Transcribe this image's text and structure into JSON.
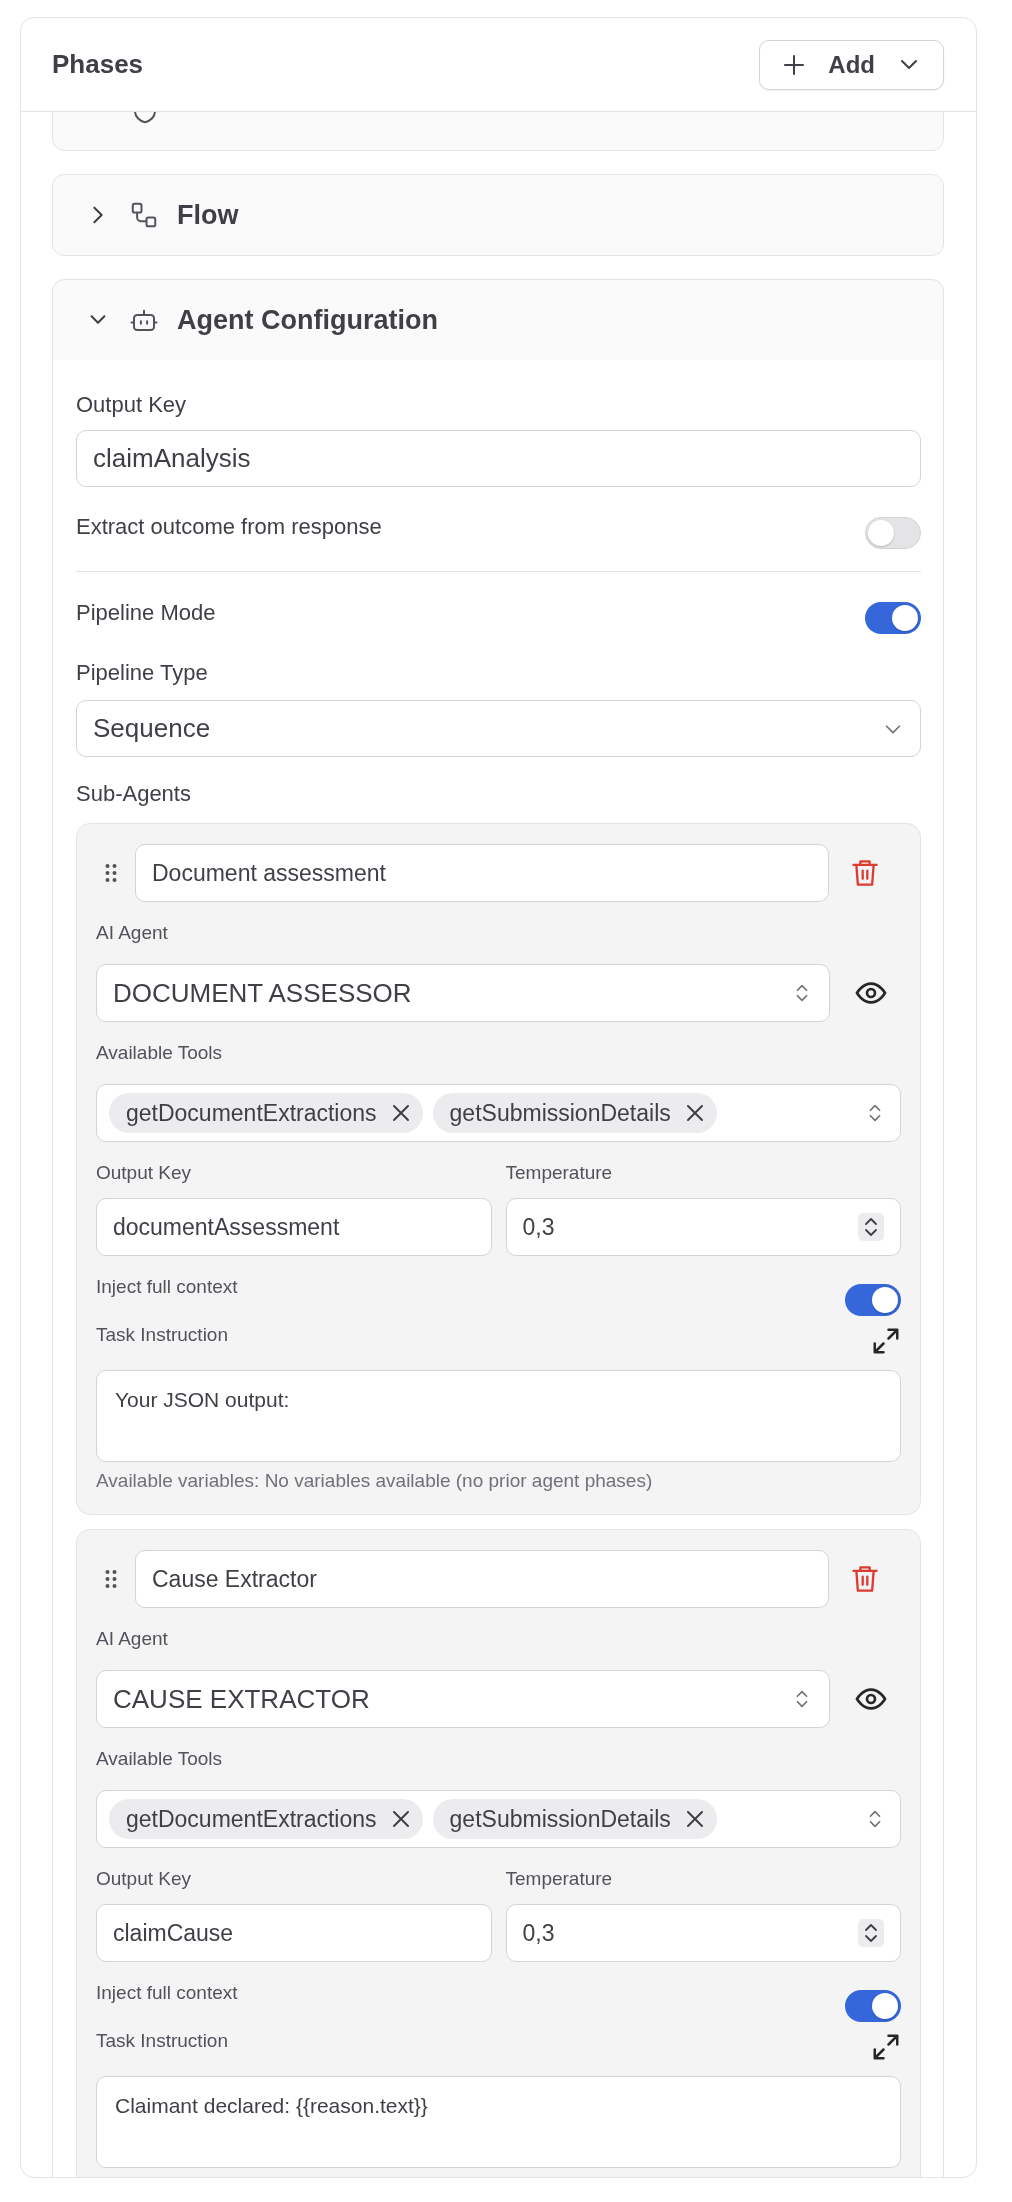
{
  "panel": {
    "title": "Phases",
    "add_button": "Add"
  },
  "scrolled_phase": {
    "kind": "shield"
  },
  "phases": [
    {
      "kind": "flow",
      "title": "Flow",
      "expanded": false
    },
    {
      "kind": "agent",
      "title": "Agent Configuration",
      "expanded": true
    }
  ],
  "config": {
    "output_key": {
      "label": "Output Key",
      "value": "claimAnalysis"
    },
    "extract_outcome": {
      "label": "Extract outcome from response",
      "on": false
    },
    "pipeline_mode": {
      "label": "Pipeline Mode",
      "on": true
    },
    "pipeline_type": {
      "label": "Pipeline Type",
      "value": "Sequence"
    },
    "sub_agents_label": "Sub-Agents",
    "sub_agents": [
      {
        "name": "Document assessment",
        "agent_label": "AI Agent",
        "agent": "DOCUMENT ASSESSOR",
        "tools_label": "Available Tools",
        "tools": [
          "getDocumentExtractions",
          "getSubmissionDetails"
        ],
        "output_key_label": "Output Key",
        "output_key": "documentAssessment",
        "temperature_label": "Temperature",
        "temperature": "0,3",
        "inject_label": "Inject full context",
        "inject_full_context": true,
        "instruction_label": "Task Instruction",
        "instruction": "Your JSON output:",
        "variables_note": "Available variables: No variables available (no prior agent phases)"
      },
      {
        "name": "Cause Extractor",
        "agent_label": "AI Agent",
        "agent": "CAUSE EXTRACTOR",
        "tools_label": "Available Tools",
        "tools": [
          "getDocumentExtractions",
          "getSubmissionDetails"
        ],
        "output_key_label": "Output Key",
        "output_key": "claimCause",
        "temperature_label": "Temperature",
        "temperature": "0,3",
        "inject_label": "Inject full context",
        "inject_full_context": true,
        "instruction_label": "Task Instruction",
        "instruction": "Claimant declared: {{reason.text}}"
      }
    ]
  }
}
